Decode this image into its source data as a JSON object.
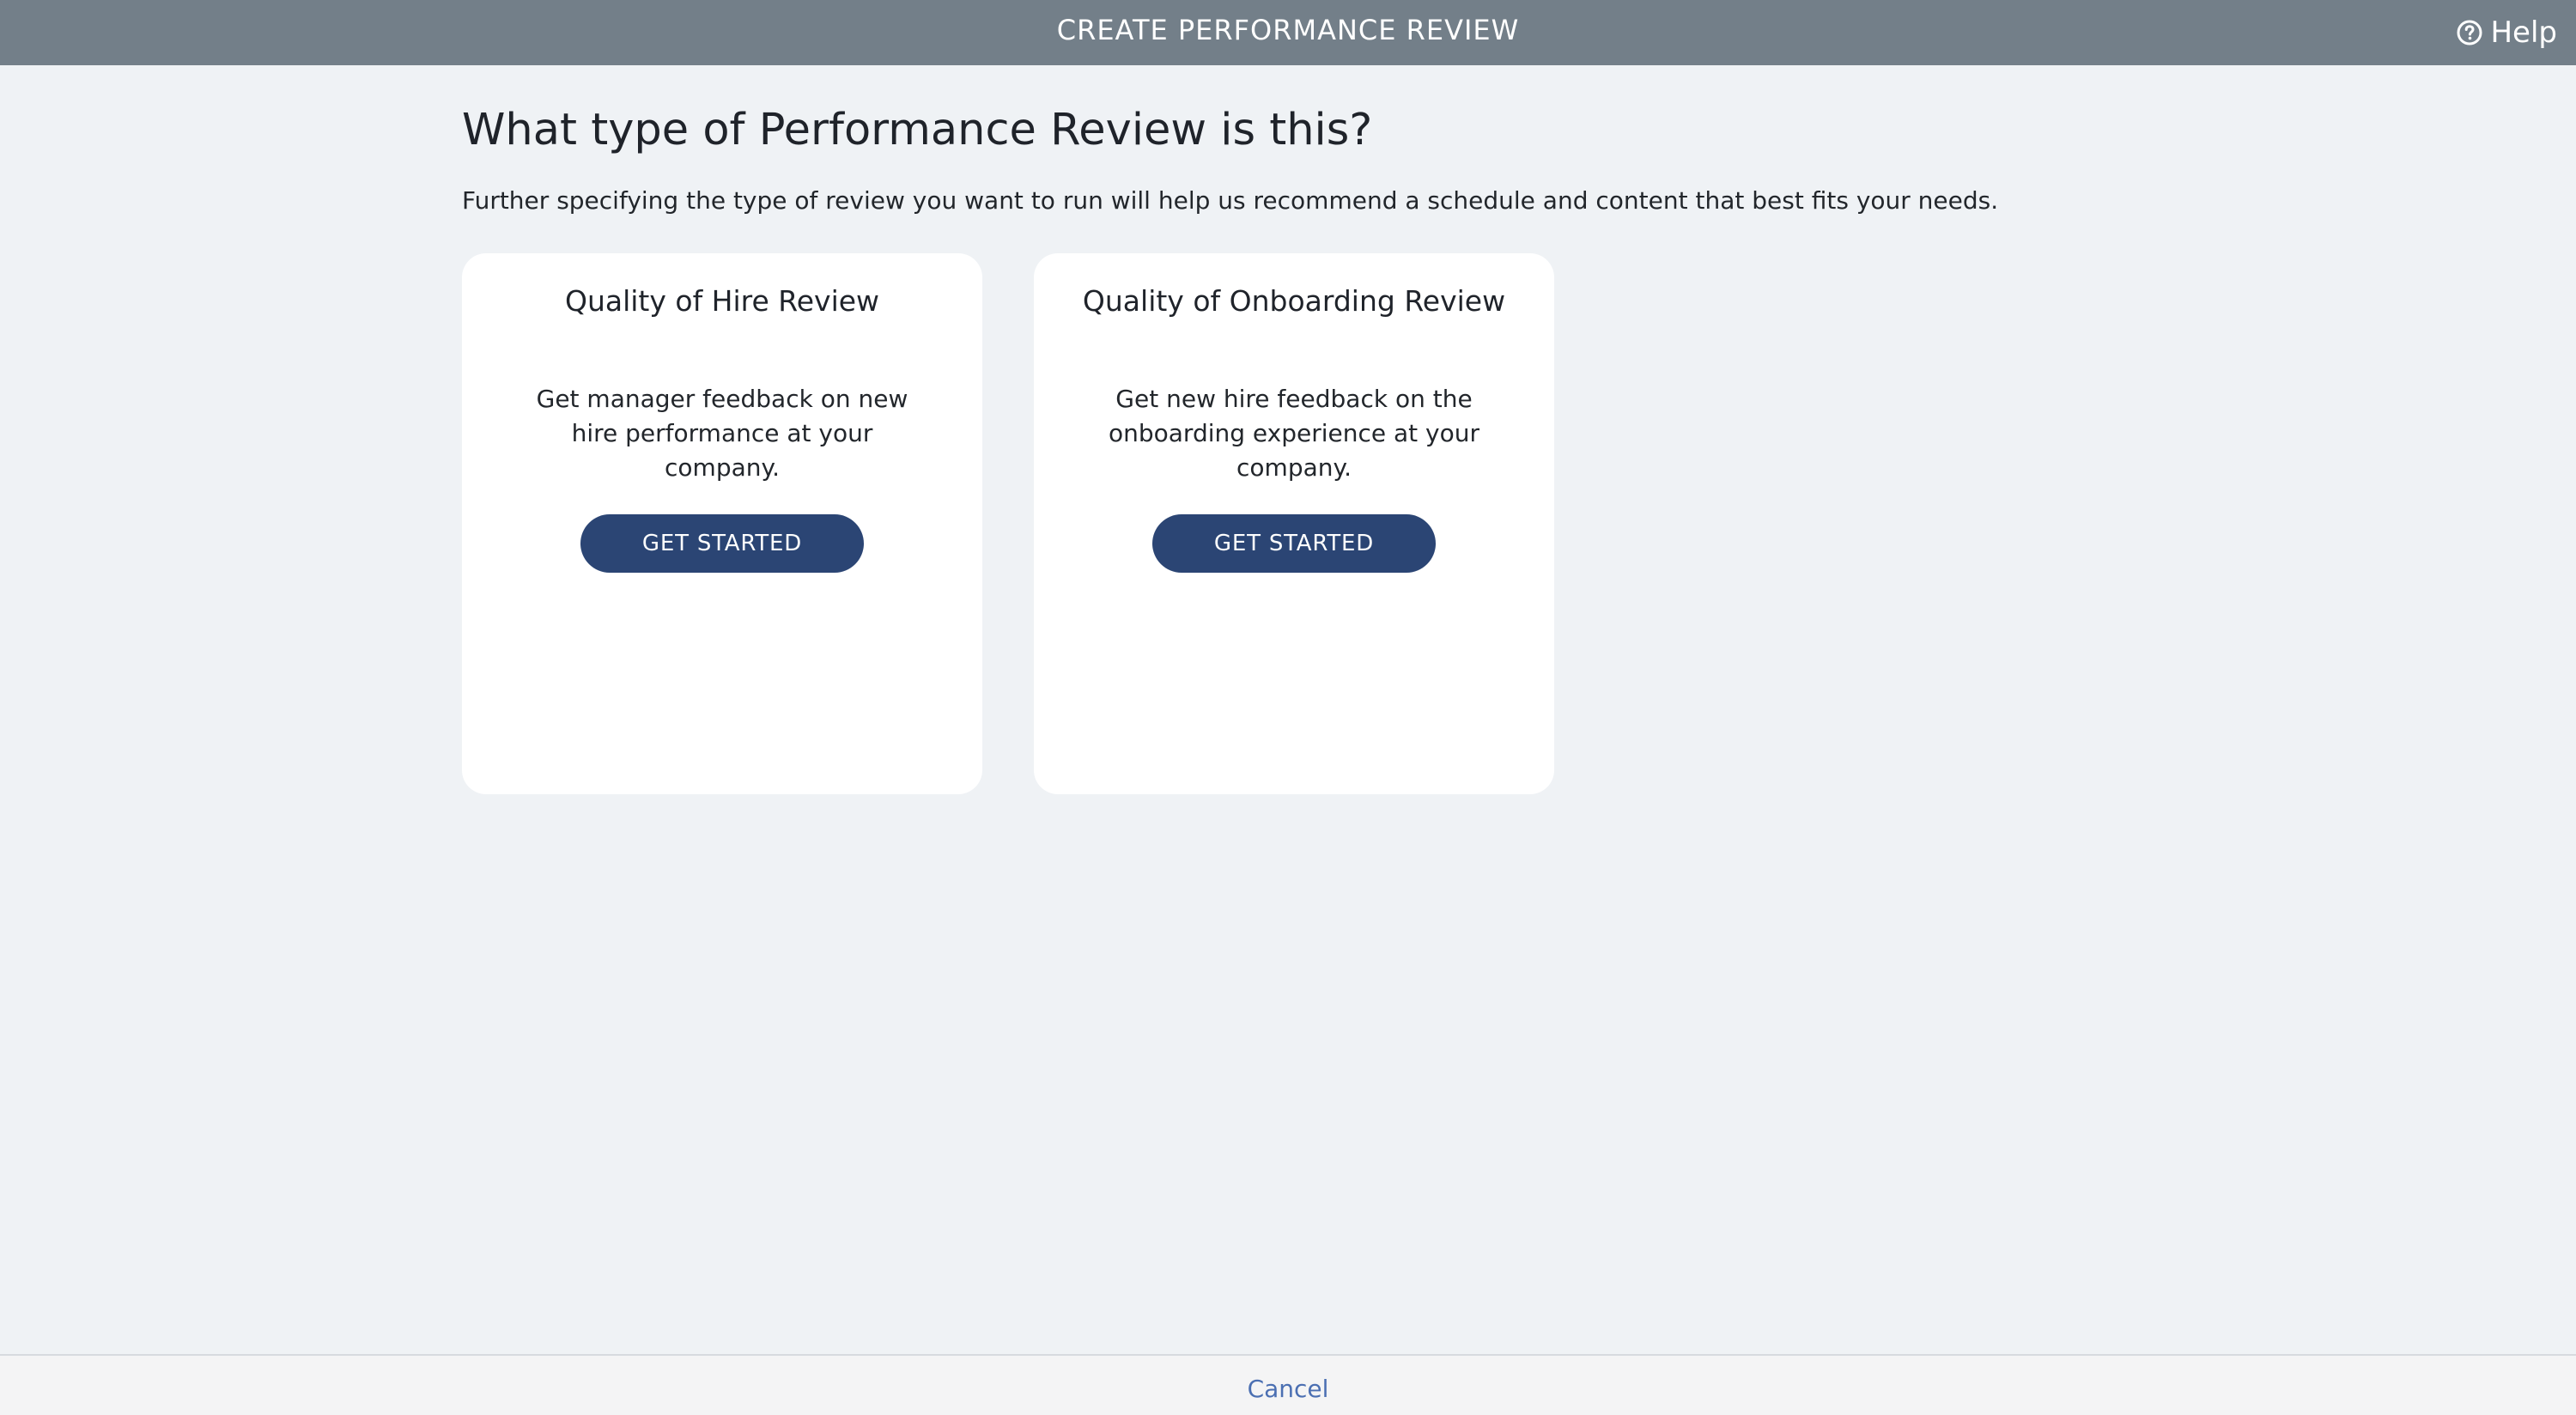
{
  "header": {
    "title": "CREATE PERFORMANCE REVIEW",
    "help_label": "Help",
    "help_icon": "question-circle-icon"
  },
  "main": {
    "title": "What type of Performance Review is this?",
    "subtitle": "Further specifying the type of review you want to run will help us recommend a schedule and content that best fits your needs.",
    "cards": [
      {
        "title": "Quality of Hire Review",
        "description": "Get manager feedback on new hire performance at your company.",
        "button_label": "GET STARTED"
      },
      {
        "title": "Quality of Onboarding Review",
        "description": "Get new hire feedback on the onboarding experience at your company.",
        "button_label": "GET STARTED"
      }
    ]
  },
  "footer": {
    "cancel_label": "Cancel"
  },
  "colors": {
    "topbar": "#737f89",
    "background": "#eff2f5",
    "button": "#2b4574",
    "link": "#4b6fb2"
  }
}
